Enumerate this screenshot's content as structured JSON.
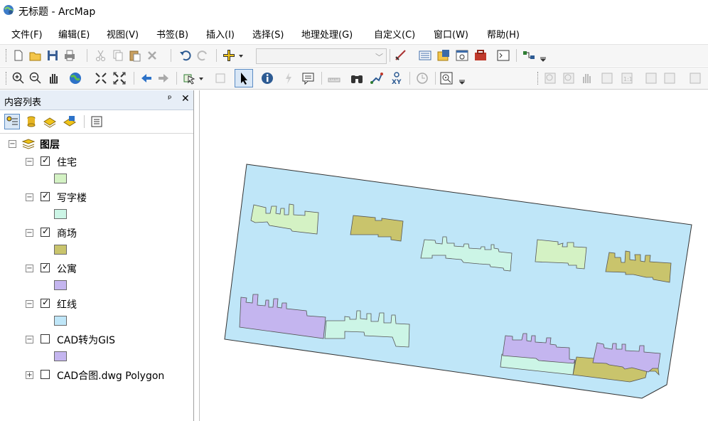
{
  "window": {
    "title": "无标题 - ArcMap"
  },
  "menu": [
    "文件(F)",
    "编辑(E)",
    "视图(V)",
    "书签(B)",
    "插入(I)",
    "选择(S)",
    "地理处理(G)",
    "自定义(C)",
    "窗口(W)",
    "帮助(H)"
  ],
  "toolbar": {
    "scale_value": ""
  },
  "toc": {
    "title": "内容列表",
    "pin_glyph": "ᵖ",
    "close_glyph": "✕",
    "root_label": "图层",
    "layers": [
      {
        "label": "住宅",
        "checked": true,
        "expanded": true,
        "color": "#d4f2c4"
      },
      {
        "label": "写字楼",
        "checked": true,
        "expanded": true,
        "color": "#ccf5e6"
      },
      {
        "label": "商场",
        "checked": true,
        "expanded": true,
        "color": "#c9c46c"
      },
      {
        "label": "公寓",
        "checked": true,
        "expanded": true,
        "color": "#c4b5ef"
      },
      {
        "label": "红线",
        "checked": true,
        "expanded": true,
        "color": "#bfe6f8"
      },
      {
        "label": "CAD转为GIS",
        "checked": false,
        "expanded": true,
        "color": "#c4b5ef"
      },
      {
        "label": "CAD合图.dwg Polygon",
        "checked": false,
        "expanded": false,
        "color": null
      }
    ]
  },
  "colors": {
    "redline": "#bfe6f8",
    "residential": "#d4f2c4",
    "office": "#ccf5e6",
    "mall": "#c9c46c",
    "apartment": "#c4b5ef"
  }
}
